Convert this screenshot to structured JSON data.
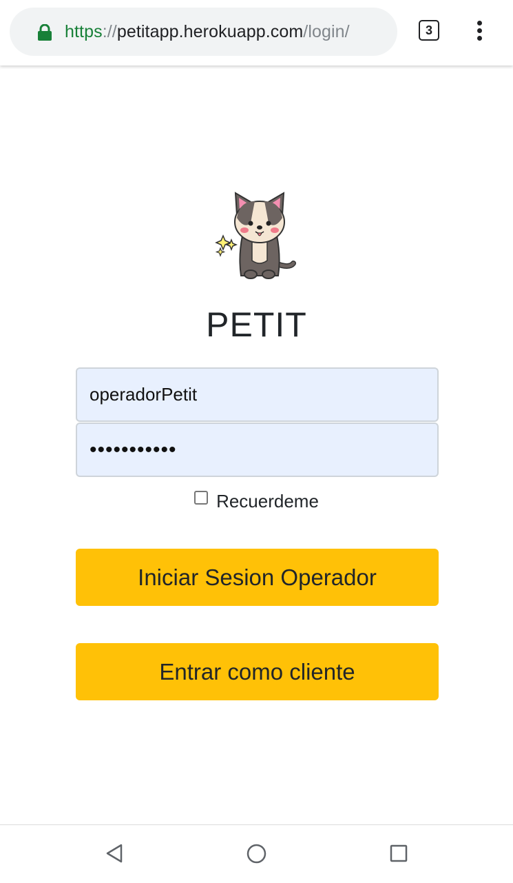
{
  "browser": {
    "url_scheme": "https",
    "url_separator": "://",
    "url_host": "petitapp.herokuapp.com",
    "url_path": "/login/",
    "tab_count": "3",
    "lock_color": "#188038"
  },
  "app": {
    "title": "PETIT"
  },
  "form": {
    "username_value": "operadorPetit",
    "password_masked": "•••••••••••",
    "remember_label": "Recuerdeme",
    "remember_checked": false
  },
  "buttons": {
    "operator_login": "Iniciar Sesion Operador",
    "client_login": "Entrar como cliente",
    "accent_color": "#ffc107"
  },
  "icons": {
    "lock": "lock-icon",
    "menu": "more-vert-icon",
    "logo": "dog-mascot-icon",
    "back": "back-triangle-icon",
    "home": "home-circle-icon",
    "recents": "recents-square-icon"
  }
}
